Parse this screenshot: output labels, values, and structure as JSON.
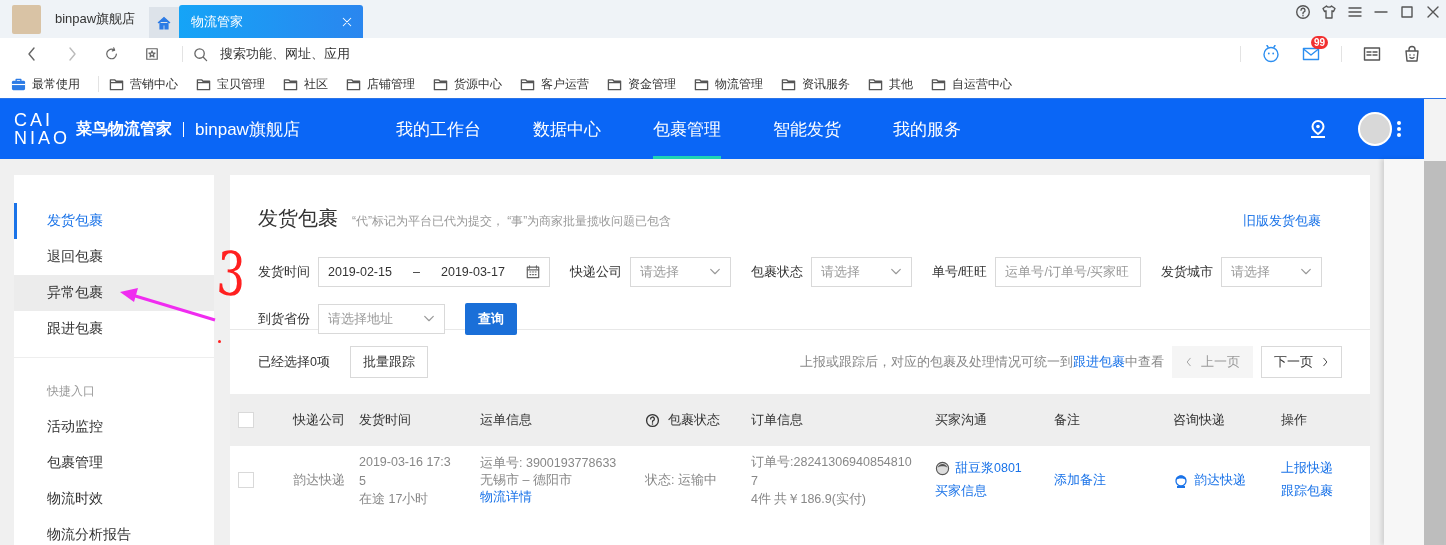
{
  "browser": {
    "tabs": [
      {
        "kind": "shop",
        "label": "binpaw旗舰店",
        "selected": false
      },
      {
        "kind": "home",
        "selected": false
      },
      {
        "kind": "page",
        "label": "物流管家",
        "selected": true
      }
    ],
    "address_bar": {
      "placeholder": "搜索功能、网址、应用"
    },
    "mail_badge": "99",
    "bookmarks": [
      {
        "kind": "toolbox",
        "label": "最常使用"
      },
      {
        "kind": "folder",
        "label": "营销中心"
      },
      {
        "kind": "folder",
        "label": "宝贝管理"
      },
      {
        "kind": "folder",
        "label": "社区"
      },
      {
        "kind": "folder",
        "label": "店铺管理"
      },
      {
        "kind": "folder",
        "label": "货源中心"
      },
      {
        "kind": "folder",
        "label": "客户运营"
      },
      {
        "kind": "folder",
        "label": "资金管理"
      },
      {
        "kind": "folder",
        "label": "物流管理"
      },
      {
        "kind": "folder",
        "label": "资讯服务"
      },
      {
        "kind": "folder",
        "label": "其他"
      },
      {
        "kind": "folder",
        "label": "自运营中心"
      }
    ]
  },
  "app_header": {
    "logo_top": "CAI",
    "logo_bottom": "NIAO",
    "brand": "菜鸟物流管家",
    "shop": "binpaw旗舰店",
    "nav": [
      {
        "label": "我的工作台",
        "selected": false
      },
      {
        "label": "数据中心",
        "selected": false
      },
      {
        "label": "包裹管理",
        "selected": true
      },
      {
        "label": "智能发货",
        "selected": false
      },
      {
        "label": "我的服务",
        "selected": false
      }
    ]
  },
  "sidebar": {
    "items": [
      {
        "label": "发货包裹",
        "selected": true,
        "hovered": false
      },
      {
        "label": "退回包裹",
        "selected": false,
        "hovered": false
      },
      {
        "label": "异常包裹",
        "selected": false,
        "hovered": true
      },
      {
        "label": "跟进包裹",
        "selected": false,
        "hovered": false
      }
    ],
    "section_title": "快捷入口",
    "shortcuts": [
      "活动监控",
      "包裹管理",
      "物流时效",
      "物流分析报告"
    ]
  },
  "panel": {
    "title": "发货包裹",
    "subtitle": "“代”标记为平台已代为提交， “事”为商家批量揽收问题已包含",
    "old_version_link": "旧版发货包裹",
    "filters": [
      {
        "kind": "date-range",
        "label": "发货时间",
        "start": "2019-02-15",
        "separator": "–",
        "end": "2019-03-17"
      },
      {
        "kind": "select",
        "label": "快递公司",
        "placeholder": "请选择"
      },
      {
        "kind": "select",
        "label": "包裹状态",
        "placeholder": "请选择"
      },
      {
        "kind": "text",
        "label": "单号/旺旺",
        "placeholder": "运单号/订单号/买家旺"
      },
      {
        "kind": "select",
        "label": "发货城市",
        "placeholder": "请选择"
      },
      {
        "kind": "select",
        "label": "到货省份",
        "placeholder": "请选择地址"
      }
    ],
    "search_button": "查询",
    "selection_count": "已经选择0项",
    "batch_button": "批量跟踪",
    "hint": {
      "before": "上报或跟踪后，对应的包裹及处理情况可统一到",
      "link": "跟进包裹",
      "after": "中查看"
    },
    "pagination": {
      "prev": {
        "label": "上一页",
        "disabled": true
      },
      "next": {
        "label": "下一页",
        "disabled": false
      }
    },
    "table": {
      "select_all_checked": false,
      "columns": [
        "快递公司",
        "发货时间",
        "运单信息",
        "包裹状态",
        "订单信息",
        "买家沟通",
        "备注",
        "咨询快递",
        "操作"
      ],
      "rows": [
        {
          "checked": false,
          "courier": "韵达快递",
          "ship_time": "2019-03-16 17:35",
          "transit": "在途 17小时",
          "waybill": "运单号: 3900193778633",
          "route": "无锡市 – 德阳市",
          "tracking_link": "物流详情",
          "status": "状态: 运输中",
          "order_no": "订单号:282413069408548107",
          "order_total": "4件 共￥186.9(实付)",
          "buyer": "甜豆浆0801",
          "buyer_info": "买家信息",
          "remark": "添加备注",
          "contact_courier": "韵达快递",
          "actions": [
            "上报快递",
            "跟踪包裹"
          ]
        }
      ]
    }
  },
  "annotation": {
    "label": "3"
  }
}
